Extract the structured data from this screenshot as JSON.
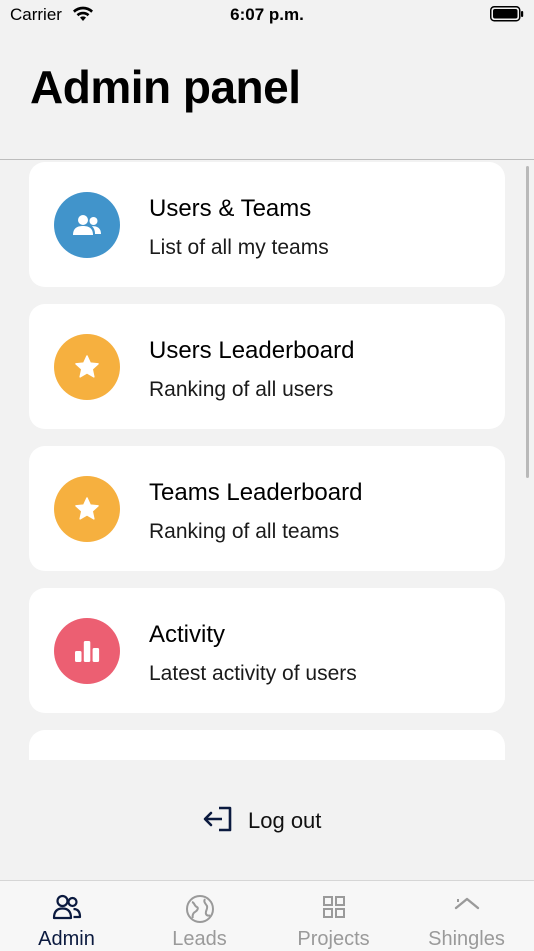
{
  "status_bar": {
    "carrier": "Carrier",
    "time": "6:07 p.m."
  },
  "header": {
    "title": "Admin panel"
  },
  "menu": {
    "items": [
      {
        "title": "Users & Teams",
        "subtitle": "List of all my teams",
        "icon": "users-icon",
        "color": "#4194cb"
      },
      {
        "title": "Users Leaderboard",
        "subtitle": "Ranking of all users",
        "icon": "star-icon",
        "color": "#f6b03f"
      },
      {
        "title": "Teams Leaderboard",
        "subtitle": "Ranking of all teams",
        "icon": "star-icon",
        "color": "#f6b03f"
      },
      {
        "title": "Activity",
        "subtitle": "Latest activity of users",
        "icon": "bar-chart-icon",
        "color": "#ec5f72"
      }
    ]
  },
  "logout": {
    "label": "Log out"
  },
  "tab_bar": {
    "tabs": [
      {
        "label": "Admin",
        "icon": "users-outline-icon",
        "active": true
      },
      {
        "label": "Leads",
        "icon": "globe-icon",
        "active": false
      },
      {
        "label": "Projects",
        "icon": "grid-icon",
        "active": false
      },
      {
        "label": "Shingles",
        "icon": "roof-icon",
        "active": false
      }
    ]
  },
  "colors": {
    "background": "#f2f2f2",
    "active_tab": "#0b1a3f",
    "inactive_tab": "#9a9a9a"
  }
}
